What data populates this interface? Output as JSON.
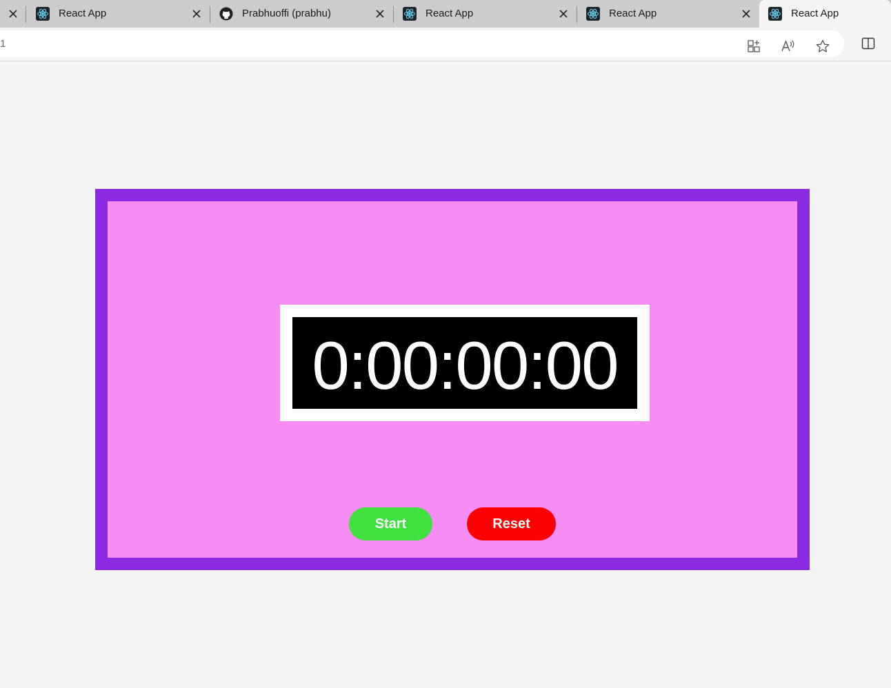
{
  "browser": {
    "tabs": [
      {
        "title": "React App",
        "icon": "react-icon",
        "active": false
      },
      {
        "title": "Prabhuoffi (prabhu)",
        "icon": "github-icon",
        "active": false
      },
      {
        "title": "React App",
        "icon": "react-icon",
        "active": false
      },
      {
        "title": "React App",
        "icon": "react-icon",
        "active": false
      },
      {
        "title": "React App",
        "icon": "react-icon",
        "active": true
      }
    ],
    "address": "1",
    "toolbar_icons": [
      "add-app-icon",
      "read-aloud-icon",
      "favorite-star-icon",
      "split-screen-icon"
    ]
  },
  "stopwatch": {
    "time": "0:00:00:00",
    "start_label": "Start",
    "reset_label": "Reset"
  },
  "colors": {
    "frame": "#8a2be2",
    "panel": "#f68cf4",
    "start": "#3ee03e",
    "reset": "#ff0000",
    "display_bg": "#000000",
    "display_text": "#ffffff"
  }
}
